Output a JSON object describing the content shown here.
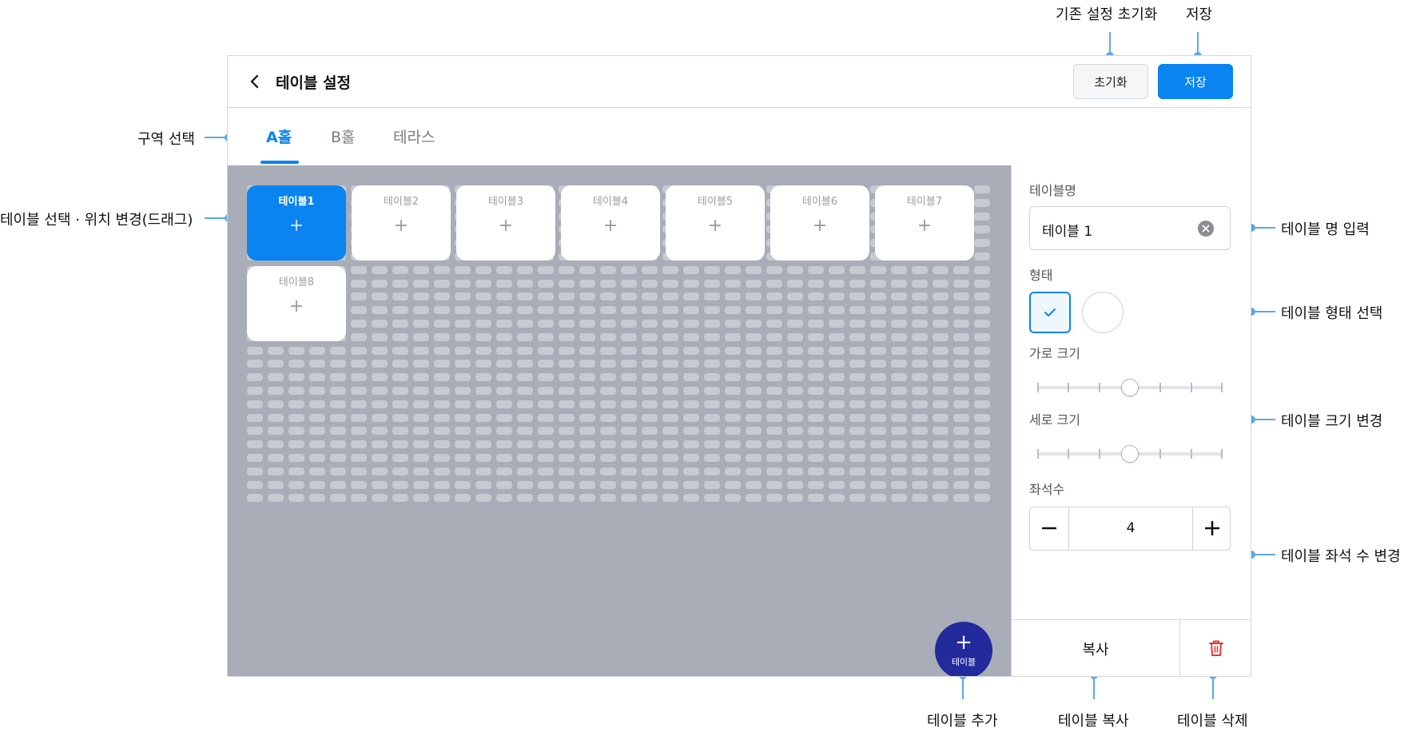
{
  "header": {
    "title": "테이블 설정",
    "reset_label": "초기화",
    "save_label": "저장"
  },
  "tabs": [
    {
      "label": "A홀",
      "active": true
    },
    {
      "label": "B홀",
      "active": false
    },
    {
      "label": "테라스",
      "active": false
    }
  ],
  "canvas": {
    "tables": [
      {
        "name": "테이블1",
        "selected": true
      },
      {
        "name": "테이블2",
        "selected": false
      },
      {
        "name": "테이블3",
        "selected": false
      },
      {
        "name": "테이블4",
        "selected": false
      },
      {
        "name": "테이블5",
        "selected": false
      },
      {
        "name": "테이블6",
        "selected": false
      },
      {
        "name": "테이블7",
        "selected": false
      },
      {
        "name": "테이블8",
        "selected": false
      }
    ],
    "plus_glyph": "+",
    "fab_label": "테이블"
  },
  "panel": {
    "name_label": "테이블명",
    "name_value": "테이블 1",
    "shape_label": "형태",
    "shape_options": [
      "square",
      "circle"
    ],
    "shape_selected": "square",
    "width_label": "가로 크기",
    "width_level": 0.5,
    "height_label": "세로 크기",
    "height_level": 0.5,
    "seats_label": "좌석수",
    "seats_value": "4",
    "copy_label": "복사"
  },
  "annotations": {
    "reset_note": "기존 설정 초기화",
    "save_note": "저장",
    "zone_note": "구역 선택",
    "drag_note": "테이블 선택 · 위치 변경(드래그)",
    "name_note": "테이블 명 입력",
    "shape_note": "테이블 형태 선택",
    "size_note": "테이블 크기 변경",
    "seats_note": "테이블 좌석 수 변경",
    "add_note": "테이블 추가",
    "copy_note": "테이블 복사",
    "delete_note": "테이블 삭제"
  },
  "colors": {
    "accent": "#0a84f0",
    "fab": "#222a9c",
    "canvas_bg": "#a8adb7",
    "annotation_line": "#5aa9e6",
    "delete": "#e5383b"
  },
  "icons": {
    "back": "chevron-left-icon",
    "clear": "clear-circle-icon",
    "check": "check-icon",
    "minus": "minus-icon",
    "plus": "plus-icon",
    "delete": "trash-icon"
  }
}
